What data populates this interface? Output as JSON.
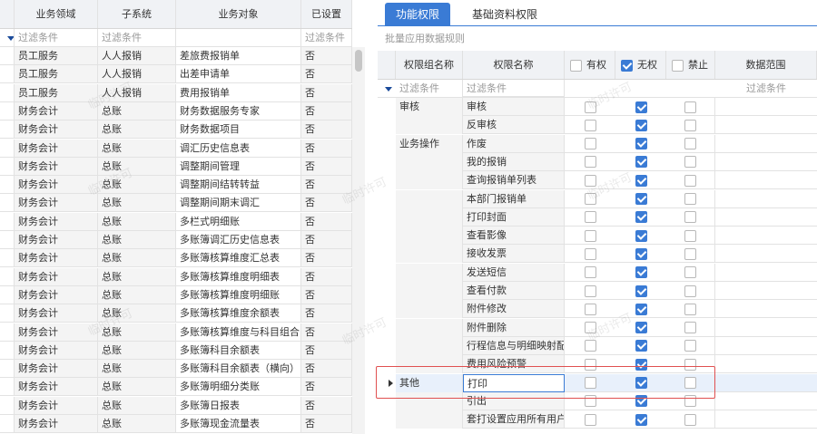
{
  "left": {
    "columns": [
      "业务领域",
      "子系统",
      "业务对象",
      "已设置"
    ],
    "filter": {
      "area": "过滤条件",
      "sub": "过滤条件",
      "obj": "",
      "set": "过滤条件"
    },
    "rows": [
      [
        "员工服务",
        "人人报销",
        "差旅费报销单",
        "否"
      ],
      [
        "员工服务",
        "人人报销",
        "出差申请单",
        "否"
      ],
      [
        "员工服务",
        "人人报销",
        "费用报销单",
        "否"
      ],
      [
        "财务会计",
        "总账",
        "财务数据服务专家",
        "否"
      ],
      [
        "财务会计",
        "总账",
        "财务数据项目",
        "否"
      ],
      [
        "财务会计",
        "总账",
        "调汇历史信息表",
        "否"
      ],
      [
        "财务会计",
        "总账",
        "调整期间管理",
        "否"
      ],
      [
        "财务会计",
        "总账",
        "调整期间结转转益",
        "否"
      ],
      [
        "财务会计",
        "总账",
        "调整期间期末调汇",
        "否"
      ],
      [
        "财务会计",
        "总账",
        "多栏式明细账",
        "否"
      ],
      [
        "财务会计",
        "总账",
        "多账簿调汇历史信息表",
        "否"
      ],
      [
        "财务会计",
        "总账",
        "多账簿核算维度汇总表",
        "否"
      ],
      [
        "财务会计",
        "总账",
        "多账簿核算维度明细表",
        "否"
      ],
      [
        "财务会计",
        "总账",
        "多账簿核算维度明细账",
        "否"
      ],
      [
        "财务会计",
        "总账",
        "多账簿核算维度余额表",
        "否"
      ],
      [
        "财务会计",
        "总账",
        "多账簿核算维度与科目组合",
        "否"
      ],
      [
        "财务会计",
        "总账",
        "多账簿科目余额表",
        "否"
      ],
      [
        "财务会计",
        "总账",
        "多账簿科目余额表（横向）",
        "否"
      ],
      [
        "财务会计",
        "总账",
        "多账簿明细分类账",
        "否"
      ],
      [
        "财务会计",
        "总账",
        "多账簿日报表",
        "否"
      ],
      [
        "财务会计",
        "总账",
        "多账簿现金流量表",
        "否"
      ]
    ]
  },
  "right": {
    "tabs": [
      "功能权限",
      "基础资料权限"
    ],
    "batch_label": "批量应用数据规则",
    "columns": {
      "group": "权限组名称",
      "name": "权限名称",
      "has": "有权",
      "no": "无权",
      "ban": "禁止",
      "scope": "数据范围"
    },
    "header_checks": {
      "has": false,
      "no": true,
      "ban": false
    },
    "filter": {
      "group": "过滤条件",
      "name": "过滤条件",
      "scope": "过滤条件"
    },
    "rows": [
      {
        "group": "审核",
        "name": "审核",
        "has": false,
        "no": true,
        "ban": false
      },
      {
        "group": "",
        "name": "反审核",
        "has": false,
        "no": true,
        "ban": false
      },
      {
        "group": "业务操作",
        "name": "作废",
        "has": false,
        "no": true,
        "ban": false
      },
      {
        "group": "",
        "name": "我的报销",
        "has": false,
        "no": true,
        "ban": false
      },
      {
        "group": "",
        "name": "查询报销单列表",
        "has": false,
        "no": true,
        "ban": false
      },
      {
        "group": "",
        "name": "本部门报销单",
        "has": false,
        "no": true,
        "ban": false
      },
      {
        "group": "",
        "name": "打印封面",
        "has": false,
        "no": true,
        "ban": false
      },
      {
        "group": "",
        "name": "查看影像",
        "has": false,
        "no": true,
        "ban": false
      },
      {
        "group": "",
        "name": "接收发票",
        "has": false,
        "no": true,
        "ban": false
      },
      {
        "group": "",
        "name": "发送短信",
        "has": false,
        "no": true,
        "ban": false
      },
      {
        "group": "",
        "name": "查看付款",
        "has": false,
        "no": true,
        "ban": false
      },
      {
        "group": "",
        "name": "附件修改",
        "has": false,
        "no": true,
        "ban": false
      },
      {
        "group": "",
        "name": "附件删除",
        "has": false,
        "no": true,
        "ban": false
      },
      {
        "group": "",
        "name": "行程信息与明细映射配",
        "has": false,
        "no": true,
        "ban": false
      },
      {
        "group": "",
        "name": "费用风险预警",
        "has": false,
        "no": true,
        "ban": false
      },
      {
        "group": "其他",
        "name": "打印",
        "has": false,
        "no": true,
        "ban": false,
        "selected": true
      },
      {
        "group": "",
        "name": "引出",
        "has": false,
        "no": true,
        "ban": false
      },
      {
        "group": "",
        "name": "套打设置应用所有用户",
        "has": false,
        "no": true,
        "ban": false
      }
    ]
  },
  "watermark": "临时许可",
  "colors": {
    "accent": "#3a7bd5",
    "highlight_border": "#e05050",
    "selected_row": "#e8f0fb"
  }
}
